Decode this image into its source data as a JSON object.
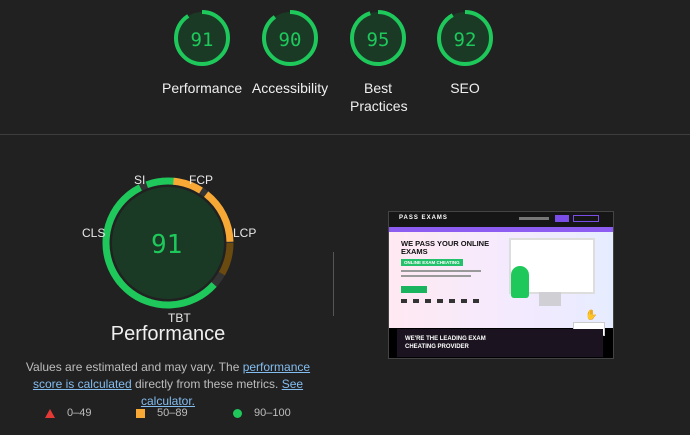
{
  "categories": [
    {
      "score": "91",
      "value": 91,
      "label": "Performance"
    },
    {
      "score": "90",
      "value": 90,
      "label": "Accessibility"
    },
    {
      "score": "95",
      "value": 95,
      "label": "Best Practices"
    },
    {
      "score": "92",
      "value": 92,
      "label": "SEO"
    }
  ],
  "performance": {
    "score": "91",
    "title": "Performance",
    "metrics": {
      "si": "SI",
      "fcp": "FCP",
      "lcp": "LCP",
      "tbt": "TBT",
      "cls": "CLS"
    },
    "description": {
      "text1": "Values are estimated and may vary. The ",
      "link1": "performance score is calculated",
      "text2": " directly from these metrics. ",
      "link2": "See calculator."
    },
    "legend": [
      {
        "range": "0–49",
        "color": "#e53935"
      },
      {
        "range": "50–89",
        "color": "#f7a835"
      },
      {
        "range": "90–100",
        "color": "#1ec85b"
      }
    ]
  },
  "screenshot": {
    "logo": "PASS EXAMS",
    "headline": "WE PASS YOUR ONLINE EXAMS",
    "tag": "ONLINE EXAM CHEATING",
    "footer": "WE'RE THE LEADING EXAM CHEATING PROVIDER"
  },
  "colors": {
    "good": "#1ec85b",
    "average": "#f7a835",
    "poor": "#e53935"
  }
}
